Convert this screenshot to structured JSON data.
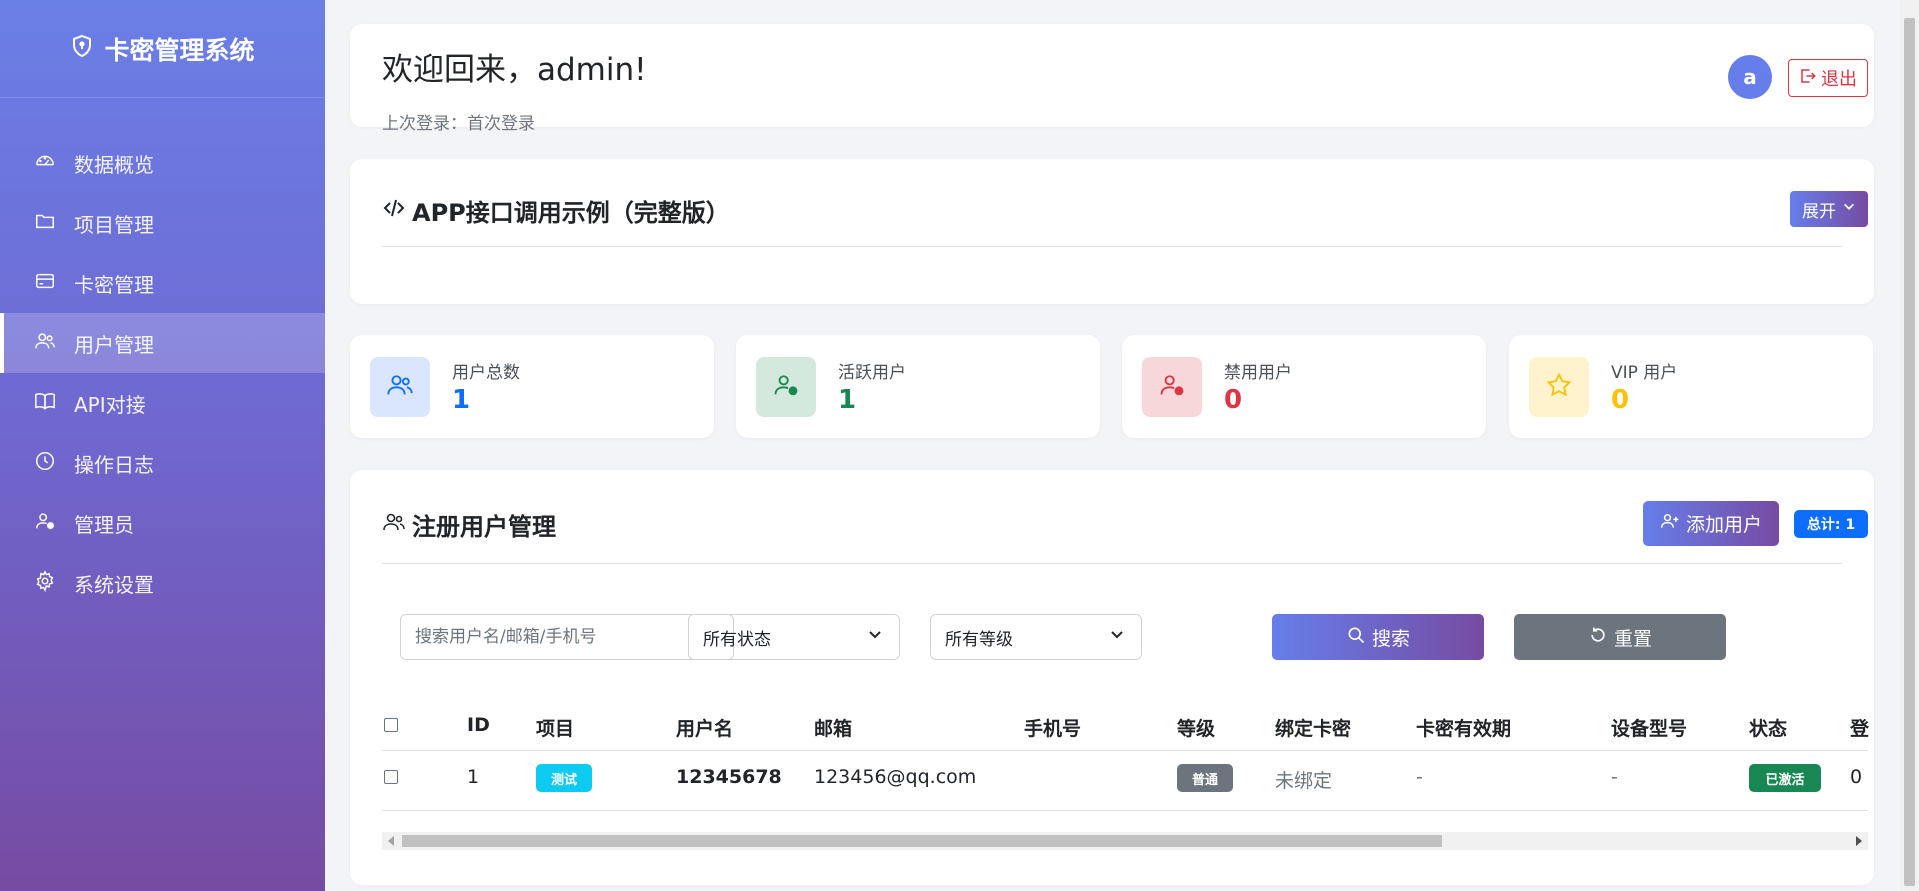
{
  "sidebar": {
    "brand": "卡密管理系统",
    "items": [
      {
        "label": "数据概览",
        "icon": "dashboard-icon"
      },
      {
        "label": "项目管理",
        "icon": "folder-icon"
      },
      {
        "label": "卡密管理",
        "icon": "card-icon"
      },
      {
        "label": "用户管理",
        "icon": "users-icon",
        "active": true
      },
      {
        "label": "API对接",
        "icon": "book-icon"
      },
      {
        "label": "操作日志",
        "icon": "clock-icon"
      },
      {
        "label": "管理员",
        "icon": "admin-icon"
      },
      {
        "label": "系统设置",
        "icon": "gear-icon"
      }
    ]
  },
  "header": {
    "welcome": "欢迎回来，admin!",
    "last_login": "上次登录：首次登录",
    "avatar_letter": "a",
    "logout_label": "退出"
  },
  "api_section": {
    "title": "APP接口调用示例（完整版）",
    "expand_label": "展开"
  },
  "stats": [
    {
      "label": "用户总数",
      "value": "1",
      "color": "#0d6efd",
      "bg": "#d9e6fd"
    },
    {
      "label": "活跃用户",
      "value": "1",
      "color": "#198754",
      "bg": "#d4e9de"
    },
    {
      "label": "禁用用户",
      "value": "0",
      "color": "#dc3545",
      "bg": "#f8d7da"
    },
    {
      "label": "VIP 用户",
      "value": "0",
      "color": "#ffc107",
      "bg": "#fff3cd"
    }
  ],
  "users": {
    "title": "注册用户管理",
    "add_label": "添加用户",
    "total_badge": "总计: 1",
    "search_placeholder": "搜索用户名/邮箱/手机号",
    "status_select": "所有状态",
    "level_select": "所有等级",
    "search_label": "搜索",
    "reset_label": "重置",
    "columns": [
      "ID",
      "项目",
      "用户名",
      "邮箱",
      "手机号",
      "等级",
      "绑定卡密",
      "卡密有效期",
      "设备型号",
      "状态",
      "登"
    ],
    "rows": [
      {
        "id": "1",
        "project": "测试",
        "username": "12345678",
        "email": "123456@qq.com",
        "phone": "",
        "level": "普通",
        "card": "未绑定",
        "card_expiry": "-",
        "device": "-",
        "status": "已激活",
        "login": "0"
      }
    ]
  },
  "colors": {
    "accent_start": "#667eea",
    "accent_end": "#764ba2",
    "project_tag": "#0dcaf0",
    "level_tag": "#6c757d",
    "status_tag": "#198754"
  }
}
